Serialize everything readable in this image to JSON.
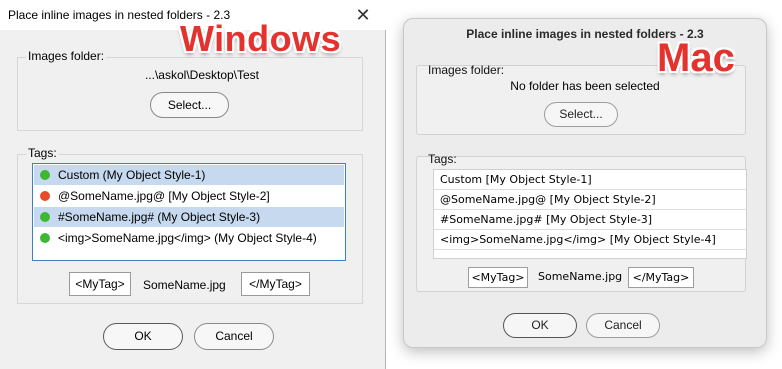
{
  "windows": {
    "window_title": "Place inline images in nested folders - 2.3",
    "close_glyph": "✕",
    "images_folder_label": "Images folder:",
    "folder_path": "...\\askol\\Desktop\\Test",
    "select_button": "Select...",
    "tags_label": "Tags:",
    "tags": [
      {
        "text": "Custom (My Object Style-1)",
        "status_color": "#3cb832",
        "selected": true
      },
      {
        "text": "@SomeName.jpg@ [My Object Style-2]",
        "status_color": "#e84a2a",
        "selected": false
      },
      {
        "text": "#SomeName.jpg# (My Object Style-3)",
        "status_color": "#3cb832",
        "selected": true
      },
      {
        "text": "<img>SomeName.jpg</img> (My Object Style-4)",
        "status_color": "#3cb832",
        "selected": false
      }
    ],
    "open_tag": "<MyTag>",
    "file_name": "SomeName.jpg",
    "close_tag": "</MyTag>",
    "ok_button": "OK",
    "cancel_button": "Cancel",
    "badge": "Windows"
  },
  "mac": {
    "window_title": "Place inline images in nested folders - 2.3",
    "images_folder_label": "Images folder:",
    "folder_status": "No folder has been selected",
    "select_button": "Select...",
    "tags_label": "Tags:",
    "tags": [
      "Custom [My Object Style-1]",
      "@SomeName.jpg@ [My Object Style-2]",
      "#SomeName.jpg# [My Object Style-3]",
      "<img>SomeName.jpg</img> [My Object Style-4]"
    ],
    "open_tag": "<MyTag>",
    "file_name": "SomeName.jpg",
    "close_tag": "</MyTag>",
    "ok_button": "OK",
    "cancel_button": "Cancel",
    "badge": "Mac"
  },
  "colors": {
    "badge_red": "#e5322e",
    "selection_blue": "#c7d9ef",
    "list_border": "#3f7fc6"
  }
}
